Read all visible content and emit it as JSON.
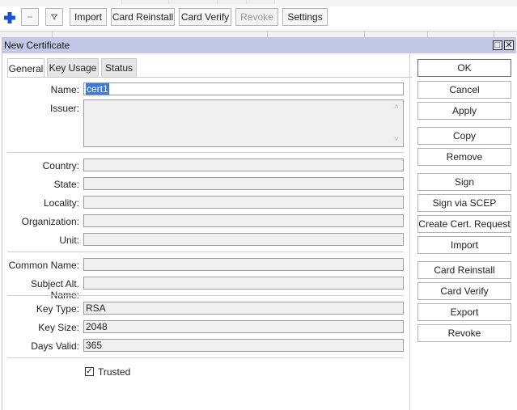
{
  "toolbar": {
    "add_icon": "plus-icon",
    "remove_icon": "minus-icon",
    "filter_icon": "funnel-icon",
    "import": "Import",
    "card_reinstall": "Card Reinstall",
    "card_verify": "Card Verify",
    "revoke": "Revoke",
    "settings": "Settings",
    "accent": "#1a4fd6"
  },
  "dialog": {
    "title": "New Certificate",
    "title_bar_color": "#c2c8e6",
    "maximize": "□",
    "close": "✕",
    "tabs": [
      "General",
      "Key Usage",
      "Status"
    ],
    "active_tab": "General",
    "fields": {
      "name_label": "Name:",
      "name_value": "cert1",
      "issuer_label": "Issuer:",
      "country_label": "Country:",
      "state_label": "State:",
      "locality_label": "Locality:",
      "organization_label": "Organization:",
      "unit_label": "Unit:",
      "common_name_label": "Common Name:",
      "subject_alt_name_label": "Subject Alt. Name:",
      "key_type_label": "Key Type:",
      "key_type_value": "RSA",
      "key_size_label": "Key Size:",
      "key_size_value": "2048",
      "days_valid_label": "Days Valid:",
      "days_valid_value": "365",
      "trusted_label": "Trusted",
      "trusted_checked": true
    },
    "buttons": {
      "ok": "OK",
      "cancel": "Cancel",
      "apply": "Apply",
      "copy": "Copy",
      "remove": "Remove",
      "sign": "Sign",
      "sign_via_scep": "Sign via SCEP",
      "create_cert_request": "Create Cert. Request",
      "import": "Import",
      "card_reinstall": "Card Reinstall",
      "card_verify": "Card Verify",
      "export": "Export",
      "revoke": "Revoke"
    }
  }
}
